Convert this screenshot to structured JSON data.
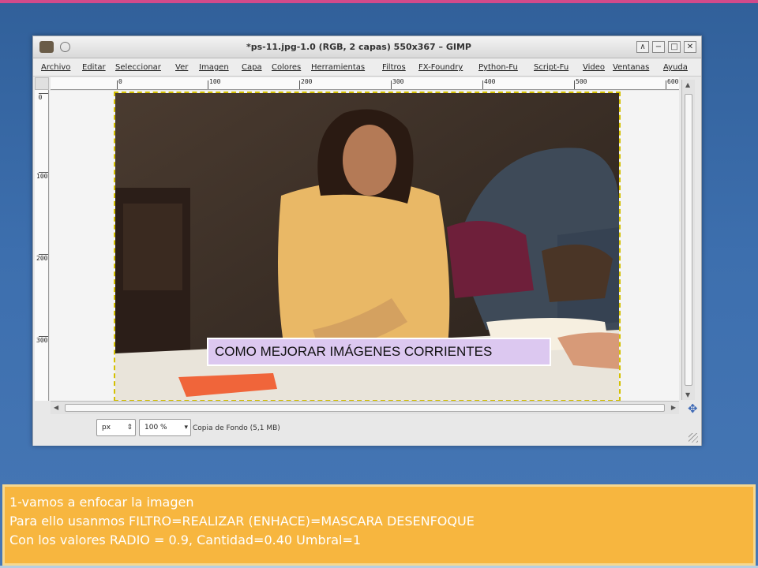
{
  "window": {
    "title": "*ps-11.jpg-1.0 (RGB, 2 capas) 550x367 – GIMP",
    "buttons": [
      "∧",
      "−",
      "□",
      "✕"
    ]
  },
  "menu": {
    "items": [
      "Archivo",
      "Editar",
      "Seleccionar",
      "Ver",
      "Imagen",
      "Capa",
      "Colores",
      "Herramientas",
      "Filtros",
      "FX-Foundry",
      "Python-Fu",
      "Script-Fu",
      "Video",
      "Ventanas",
      "Ayuda"
    ]
  },
  "rulers": {
    "top_labels": [
      "0",
      "100",
      "200",
      "300",
      "400",
      "500",
      "600"
    ],
    "left_labels": [
      "0",
      "100",
      "200",
      "300"
    ]
  },
  "statusbar": {
    "unit": "px",
    "zoom": "100 %",
    "layer_info": "Copia de Fondo (5,1 MB)"
  },
  "overlay": {
    "text": "COMO MEJORAR  IMÁGENES CORRIENTES"
  },
  "caption": {
    "line1": "1-vamos  a enfocar  la imagen",
    "line2": "Para ello usanmos FILTRO=REALIZAR  (ENHACE)=MASCARA DESENFOQUE",
    "line3": "Con los valores RADIO = 0.9, Cantidad=0.40  Umbral=1"
  },
  "colors": {
    "background": "#3d6fae",
    "caption_bg": "#f7b63f",
    "overlay_bg": "#dcc8f0",
    "accent_top": "#d24a8a"
  }
}
